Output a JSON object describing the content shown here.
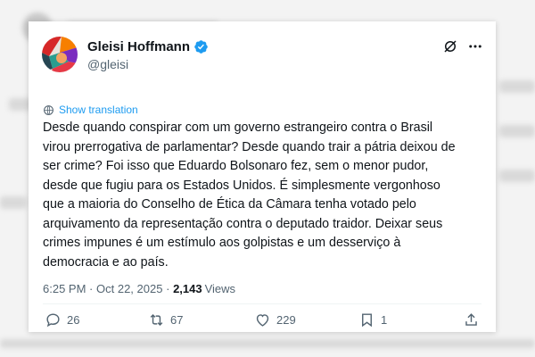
{
  "author": {
    "name": "Gleisi Hoffmann",
    "handle": "@gleisi",
    "verified": true,
    "accent_color": "#1d9bf0"
  },
  "icons": {
    "avatar": "avatar-image",
    "verified": "verified-badge-icon",
    "grok": "grok-icon",
    "more": "more-options-icon",
    "translate": "globe-icon",
    "reply": "reply-icon",
    "repost": "repost-icon",
    "like": "heart-icon",
    "bookmark": "bookmark-icon",
    "share": "share-icon"
  },
  "translate_label": "Show translation",
  "post_text": "Desde quando conspirar com um governo estrangeiro contra o Brasil\nvirou prerrogativa de parlamentar? Desde quando trair a pátria deixou de\nser crime? Foi isso que Eduardo Bolsonaro fez, sem o menor pudor,\ndesde que fugiu para os Estados Unidos. É simplesmente vergonhoso\nque a maioria do Conselho de Ética da Câmara tenha votado pelo\narquivamento da representação contra o deputado traidor. Deixar seus\ncrimes impunes é um estímulo aos golpistas e um desserviço à\ndemocracia e ao país.",
  "meta": {
    "time": "6:25 PM",
    "separator": "·",
    "date": "Oct 22, 2025",
    "dot2": "·",
    "views_count": "2,143",
    "views_label": "Views"
  },
  "actions": {
    "replies": "26",
    "reposts": "67",
    "likes": "229",
    "bookmarks": "1"
  }
}
